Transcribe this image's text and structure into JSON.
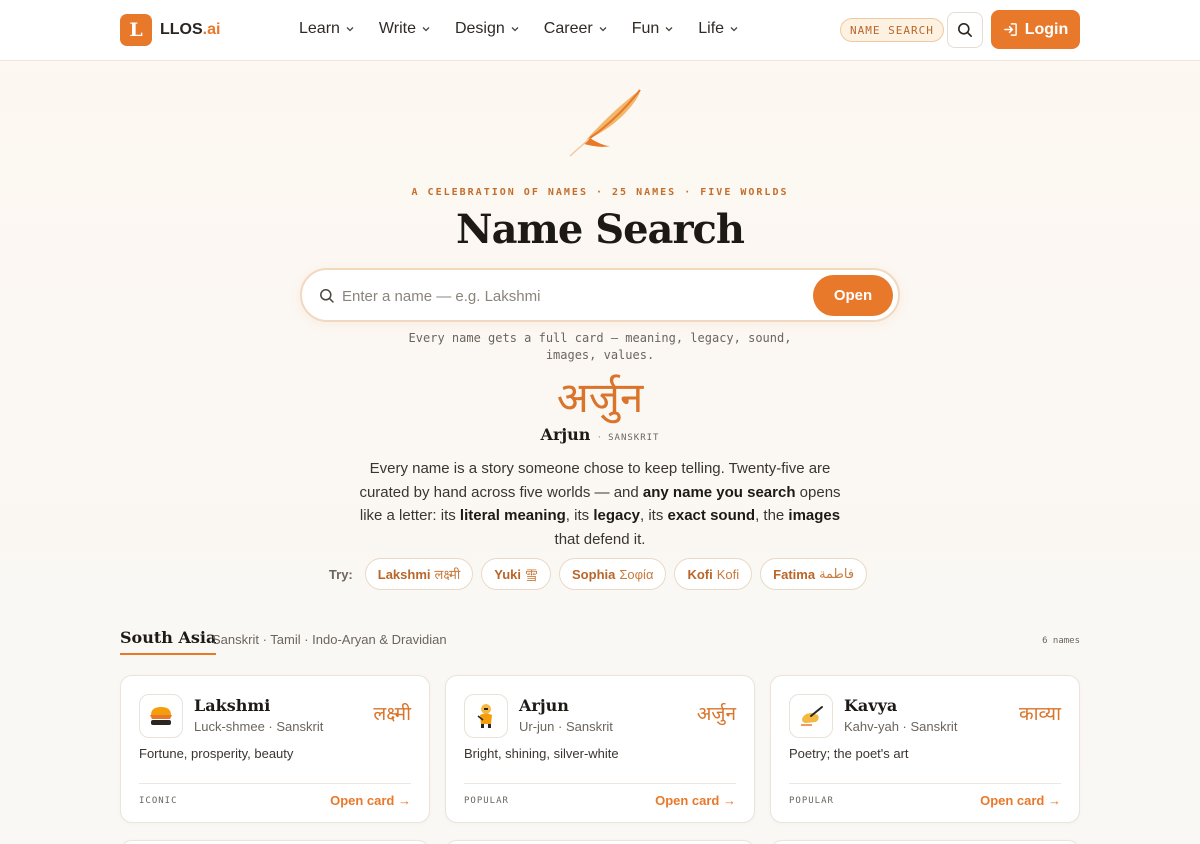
{
  "header": {
    "logo_letter": "L",
    "logo_name": "LLOS",
    "logo_suffix": ".ai",
    "nav": [
      {
        "label": "Learn"
      },
      {
        "label": "Write"
      },
      {
        "label": "Design"
      },
      {
        "label": "Career"
      },
      {
        "label": "Fun"
      },
      {
        "label": "Life"
      }
    ],
    "tag": "NAME SEARCH",
    "login_label": "Login"
  },
  "hero": {
    "eyebrow": "A CELEBRATION OF NAMES · 25 NAMES · FIVE WORLDS",
    "title": "Name Search",
    "search_placeholder": "Enter a name — e.g. Lakshmi",
    "search_value": "",
    "open_label": "Open",
    "hint": "Every name gets a full card — meaning, legacy, sound, images, values.",
    "feature": {
      "script": "अर्जुन",
      "name": "Arjun",
      "separator": "·",
      "lang": "SANSKRIT"
    },
    "lede_parts": {
      "p1": "Every name is a story someone chose to keep telling. Twenty-five are curated by hand across five worlds — and ",
      "b1": "any name you search",
      "p2": " opens like a letter: its ",
      "b2": "literal meaning",
      "p3": ", its ",
      "b3": "legacy",
      "p4": ", its ",
      "b4": "exact sound",
      "p5": ", the ",
      "b5": "images",
      "p6": " that defend it."
    },
    "try_label": "Try:",
    "try_chips": [
      {
        "name": "Lakshmi",
        "native": "लक्ष्मी"
      },
      {
        "name": "Yuki",
        "native": "雪"
      },
      {
        "name": "Sophia",
        "native": "Σοφία"
      },
      {
        "name": "Kofi",
        "native": "Kofi"
      },
      {
        "name": "Fatima",
        "native": "فاطمة"
      }
    ]
  },
  "section": {
    "title": "South Asia",
    "subtitle": "Sanskrit · Tamil · Indo-Aryan & Dravidian",
    "count": "6 names",
    "cards": [
      {
        "name": "Lakshmi",
        "pronunciation": "Luck-shmee · Sanskrit",
        "native": "लक्ष्मी",
        "meaning": "Fortune, prosperity, beauty",
        "tag": "ICONIC",
        "open": "Open card →",
        "icon": "oil-lamp-icon"
      },
      {
        "name": "Arjun",
        "pronunciation": "Ur-jun · Sanskrit",
        "native": "अर्जुन",
        "meaning": "Bright, shining, silver-white",
        "tag": "POPULAR",
        "open": "Open card →",
        "icon": "archer-icon"
      },
      {
        "name": "Kavya",
        "pronunciation": "Kahv-yah · Sanskrit",
        "native": "काव्या",
        "meaning": "Poetry; the poet's art",
        "tag": "POPULAR",
        "open": "Open card →",
        "icon": "writing-hand-icon"
      }
    ]
  },
  "colors": {
    "accent": "#e8792b",
    "accent_text": "#b8662a",
    "ink": "#1d1915"
  }
}
